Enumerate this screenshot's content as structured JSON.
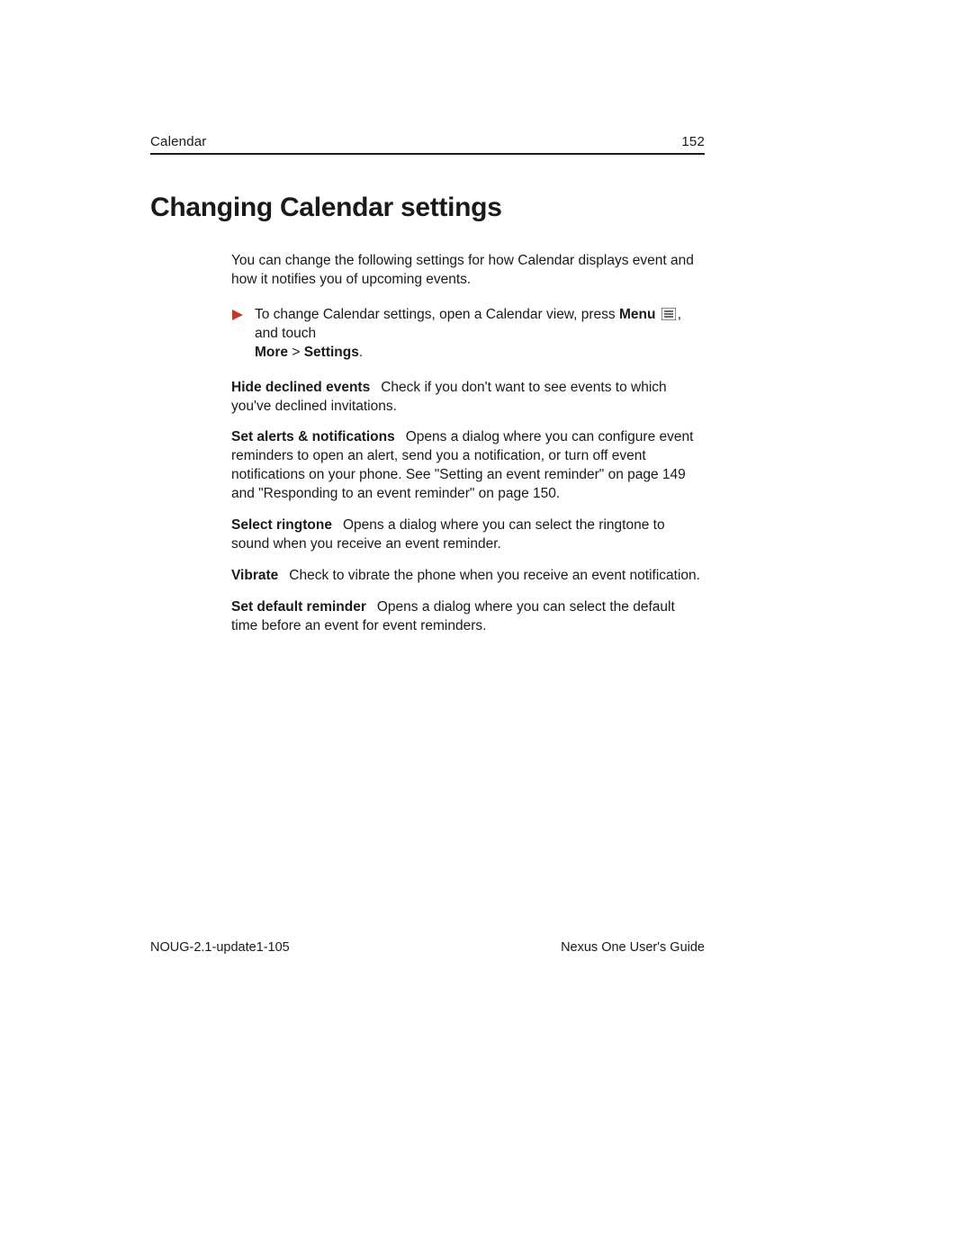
{
  "header": {
    "section": "Calendar",
    "page_number": "152"
  },
  "title": "Changing Calendar settings",
  "intro": "You can change the following settings for how Calendar displays event and how it notifies you of upcoming events.",
  "step": {
    "pre": "To change Calendar settings, open a Calendar view, press ",
    "menu_bold": "Menu",
    "post_menu": ", and touch",
    "more_bold": "More",
    "gt": " > ",
    "settings_bold": "Settings",
    "period": "."
  },
  "items": [
    {
      "label": "Hide declined events",
      "text": "Check if you don't want to see events to which you've declined invitations."
    },
    {
      "label": "Set alerts & notifications",
      "text": "Opens a dialog where you can configure event reminders to open an alert, send you a notification, or turn off event notifications on your phone. See \"Setting an event reminder\" on page 149 and \"Responding to an event reminder\" on page 150."
    },
    {
      "label": "Select ringtone",
      "text": "Opens a dialog where you can select the ringtone to sound when you receive an event reminder."
    },
    {
      "label": "Vibrate",
      "text": "Check to vibrate the phone when you receive an event notification."
    },
    {
      "label": "Set default reminder",
      "text": "Opens a dialog where you can select the default time before an event for event reminders."
    }
  ],
  "footer": {
    "doc_id": "NOUG-2.1-update1-105",
    "guide_title": "Nexus One User's Guide"
  }
}
